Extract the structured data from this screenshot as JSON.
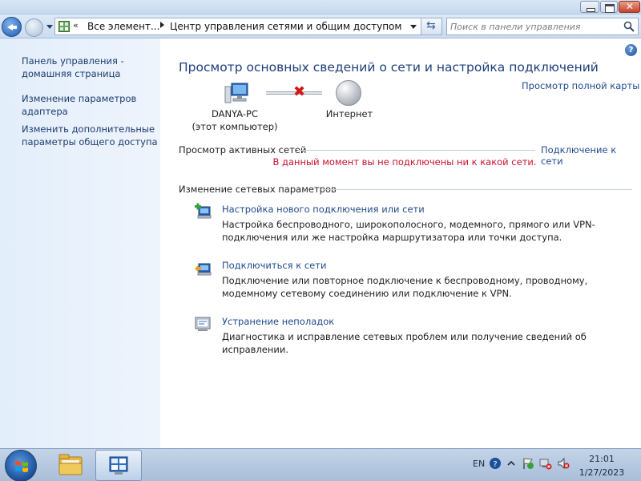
{
  "colors": {
    "link": "#1e4a8c",
    "title": "#1e3f78",
    "error": "#c8102e",
    "left_pane": "#e3eefb",
    "taskbar": "#b6c9e1"
  },
  "icons": {
    "back": "back-arrow-icon",
    "forward": "forward-arrow-icon",
    "refresh": "refresh-icon",
    "search": "search-icon",
    "help": "help-icon",
    "computer": "computer-icon",
    "internet": "globe-icon",
    "disconnected": "red-x-icon",
    "new_connection": "new-connection-icon",
    "connect": "connect-network-icon",
    "troubleshoot": "troubleshoot-icon"
  },
  "address": {
    "chevrons": "«",
    "segment1": "Все элемент...",
    "segment2": "Центр управления сетями и общим доступом",
    "refresh_glyph": "⇆"
  },
  "search": {
    "placeholder": "Поиск в панели управления"
  },
  "sidebar": {
    "items": [
      {
        "label": "Панель управления - домашняя страница"
      },
      {
        "label": "Изменение параметров адаптера"
      },
      {
        "label": "Изменить дополнительные параметры общего доступа"
      }
    ]
  },
  "main": {
    "help_glyph": "?",
    "title": "Просмотр основных сведений о сети и настройка подключений",
    "full_map_link": "Просмотр полной карты",
    "computer_name": "DANYA-PC",
    "computer_sub": "(этот компьютер)",
    "internet_label": "Интернет",
    "x_glyph": "✖",
    "active_networks_heading": "Просмотр активных сетей",
    "connect_link": "Подключение к сети",
    "status_message": "В данный момент вы не подключены ни к какой сети.",
    "change_heading": "Изменение сетевых параметров",
    "tasks": [
      {
        "link": "Настройка нового подключения или сети",
        "description": "Настройка беспроводного, широкополосного, модемного, прямого или VPN-подключения или же настройка маршрутизатора или точки доступа."
      },
      {
        "link": "Подключиться к сети",
        "description": "Подключение или повторное подключение к беспроводному, проводному, модемному сетевому соединению или подключение к VPN."
      },
      {
        "link": "Устранение неполадок",
        "description": "Диагностика и исправление сетевых проблем или получение сведений об исправлении."
      }
    ]
  },
  "taskbar": {
    "language": "EN",
    "time": "21:01",
    "date": "1/27/2023"
  }
}
